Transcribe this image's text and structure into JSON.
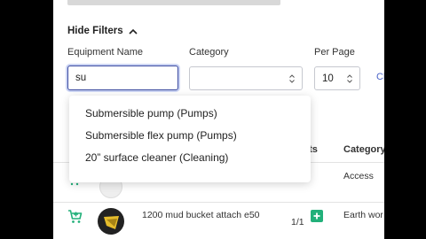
{
  "filters": {
    "toggle_label": "Hide Filters",
    "equipment_name_label": "Equipment Name",
    "equipment_name_value": "su",
    "category_label": "Category",
    "category_value": "",
    "per_page_label": "Per Page",
    "per_page_value": "10",
    "clear_link_partial": "Cl"
  },
  "autocomplete": {
    "options": [
      "Submersible pump (Pumps)",
      "Submersible flex pump (Pumps)",
      "20” surface cleaner (Cleaning)"
    ]
  },
  "table": {
    "headers": {
      "assets_partial": "ets",
      "category": "Category"
    },
    "rows": [
      {
        "name": "",
        "assets": "",
        "category": "Access"
      },
      {
        "name": "1200 mud bucket attach e50",
        "assets": "1/1",
        "category": "Earth wor"
      }
    ]
  },
  "colors": {
    "accent": "#3b4aa0",
    "add_green": "#22b07a"
  }
}
